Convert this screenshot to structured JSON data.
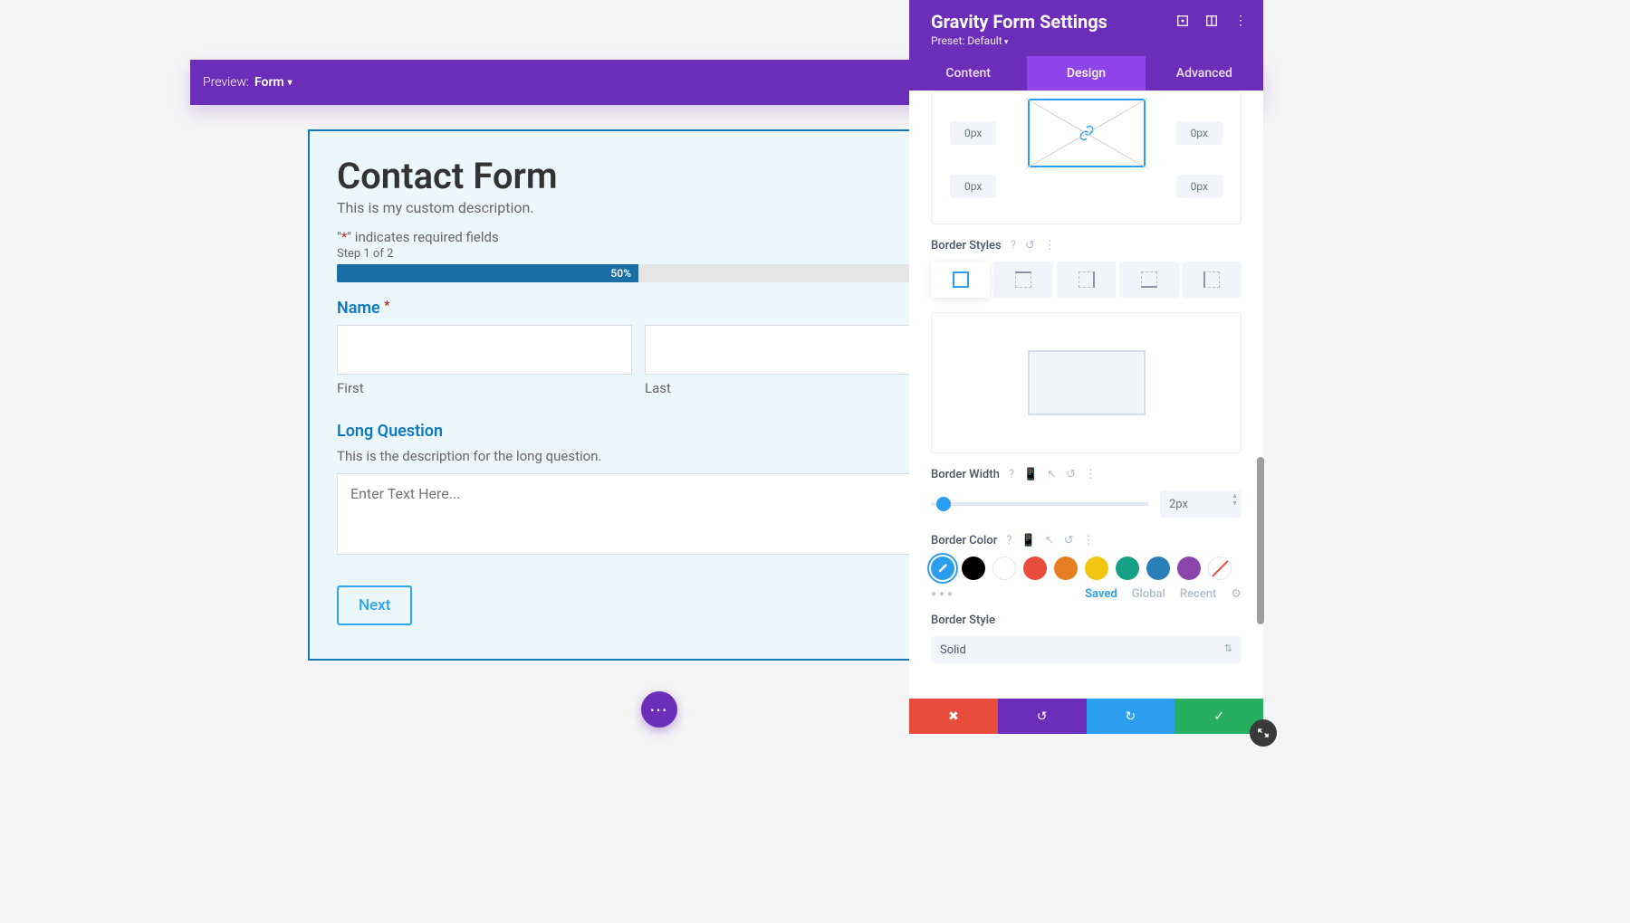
{
  "preview": {
    "label": "Preview:",
    "target": "Form"
  },
  "form": {
    "title": "Contact Form",
    "description": "This is my custom description.",
    "required_note_prefix": "\"",
    "required_note_suffix": "\" indicates required fields",
    "step": "Step 1 of 2",
    "progress": "50%",
    "fields": {
      "name": {
        "label": "Name",
        "first": "First",
        "last": "Last"
      },
      "long": {
        "label": "Long Question",
        "desc": "This is the description for the long question.",
        "placeholder": "Enter Text Here..."
      }
    },
    "next": "Next"
  },
  "panel": {
    "title": "Gravity Form Settings",
    "preset": "Preset: Default",
    "tabs": {
      "content": "Content",
      "design": "Design",
      "advanced": "Advanced"
    },
    "margin": {
      "tl": "0px",
      "tr": "0px",
      "bl": "0px",
      "br": "0px"
    },
    "border_styles_label": "Border Styles",
    "border_width_label": "Border Width",
    "border_width_value": "2px",
    "border_color_label": "Border Color",
    "color_tabs": {
      "saved": "Saved",
      "global": "Global",
      "recent": "Recent"
    },
    "border_style_label": "Border Style",
    "border_style_value": "Solid",
    "colors": {
      "black": "#000000",
      "white": "#ffffff",
      "red": "#e74c3c",
      "orange": "#e67e22",
      "yellow": "#f1c40f",
      "green": "#16a085",
      "blue": "#2980b9",
      "purple": "#8e44ad"
    }
  }
}
